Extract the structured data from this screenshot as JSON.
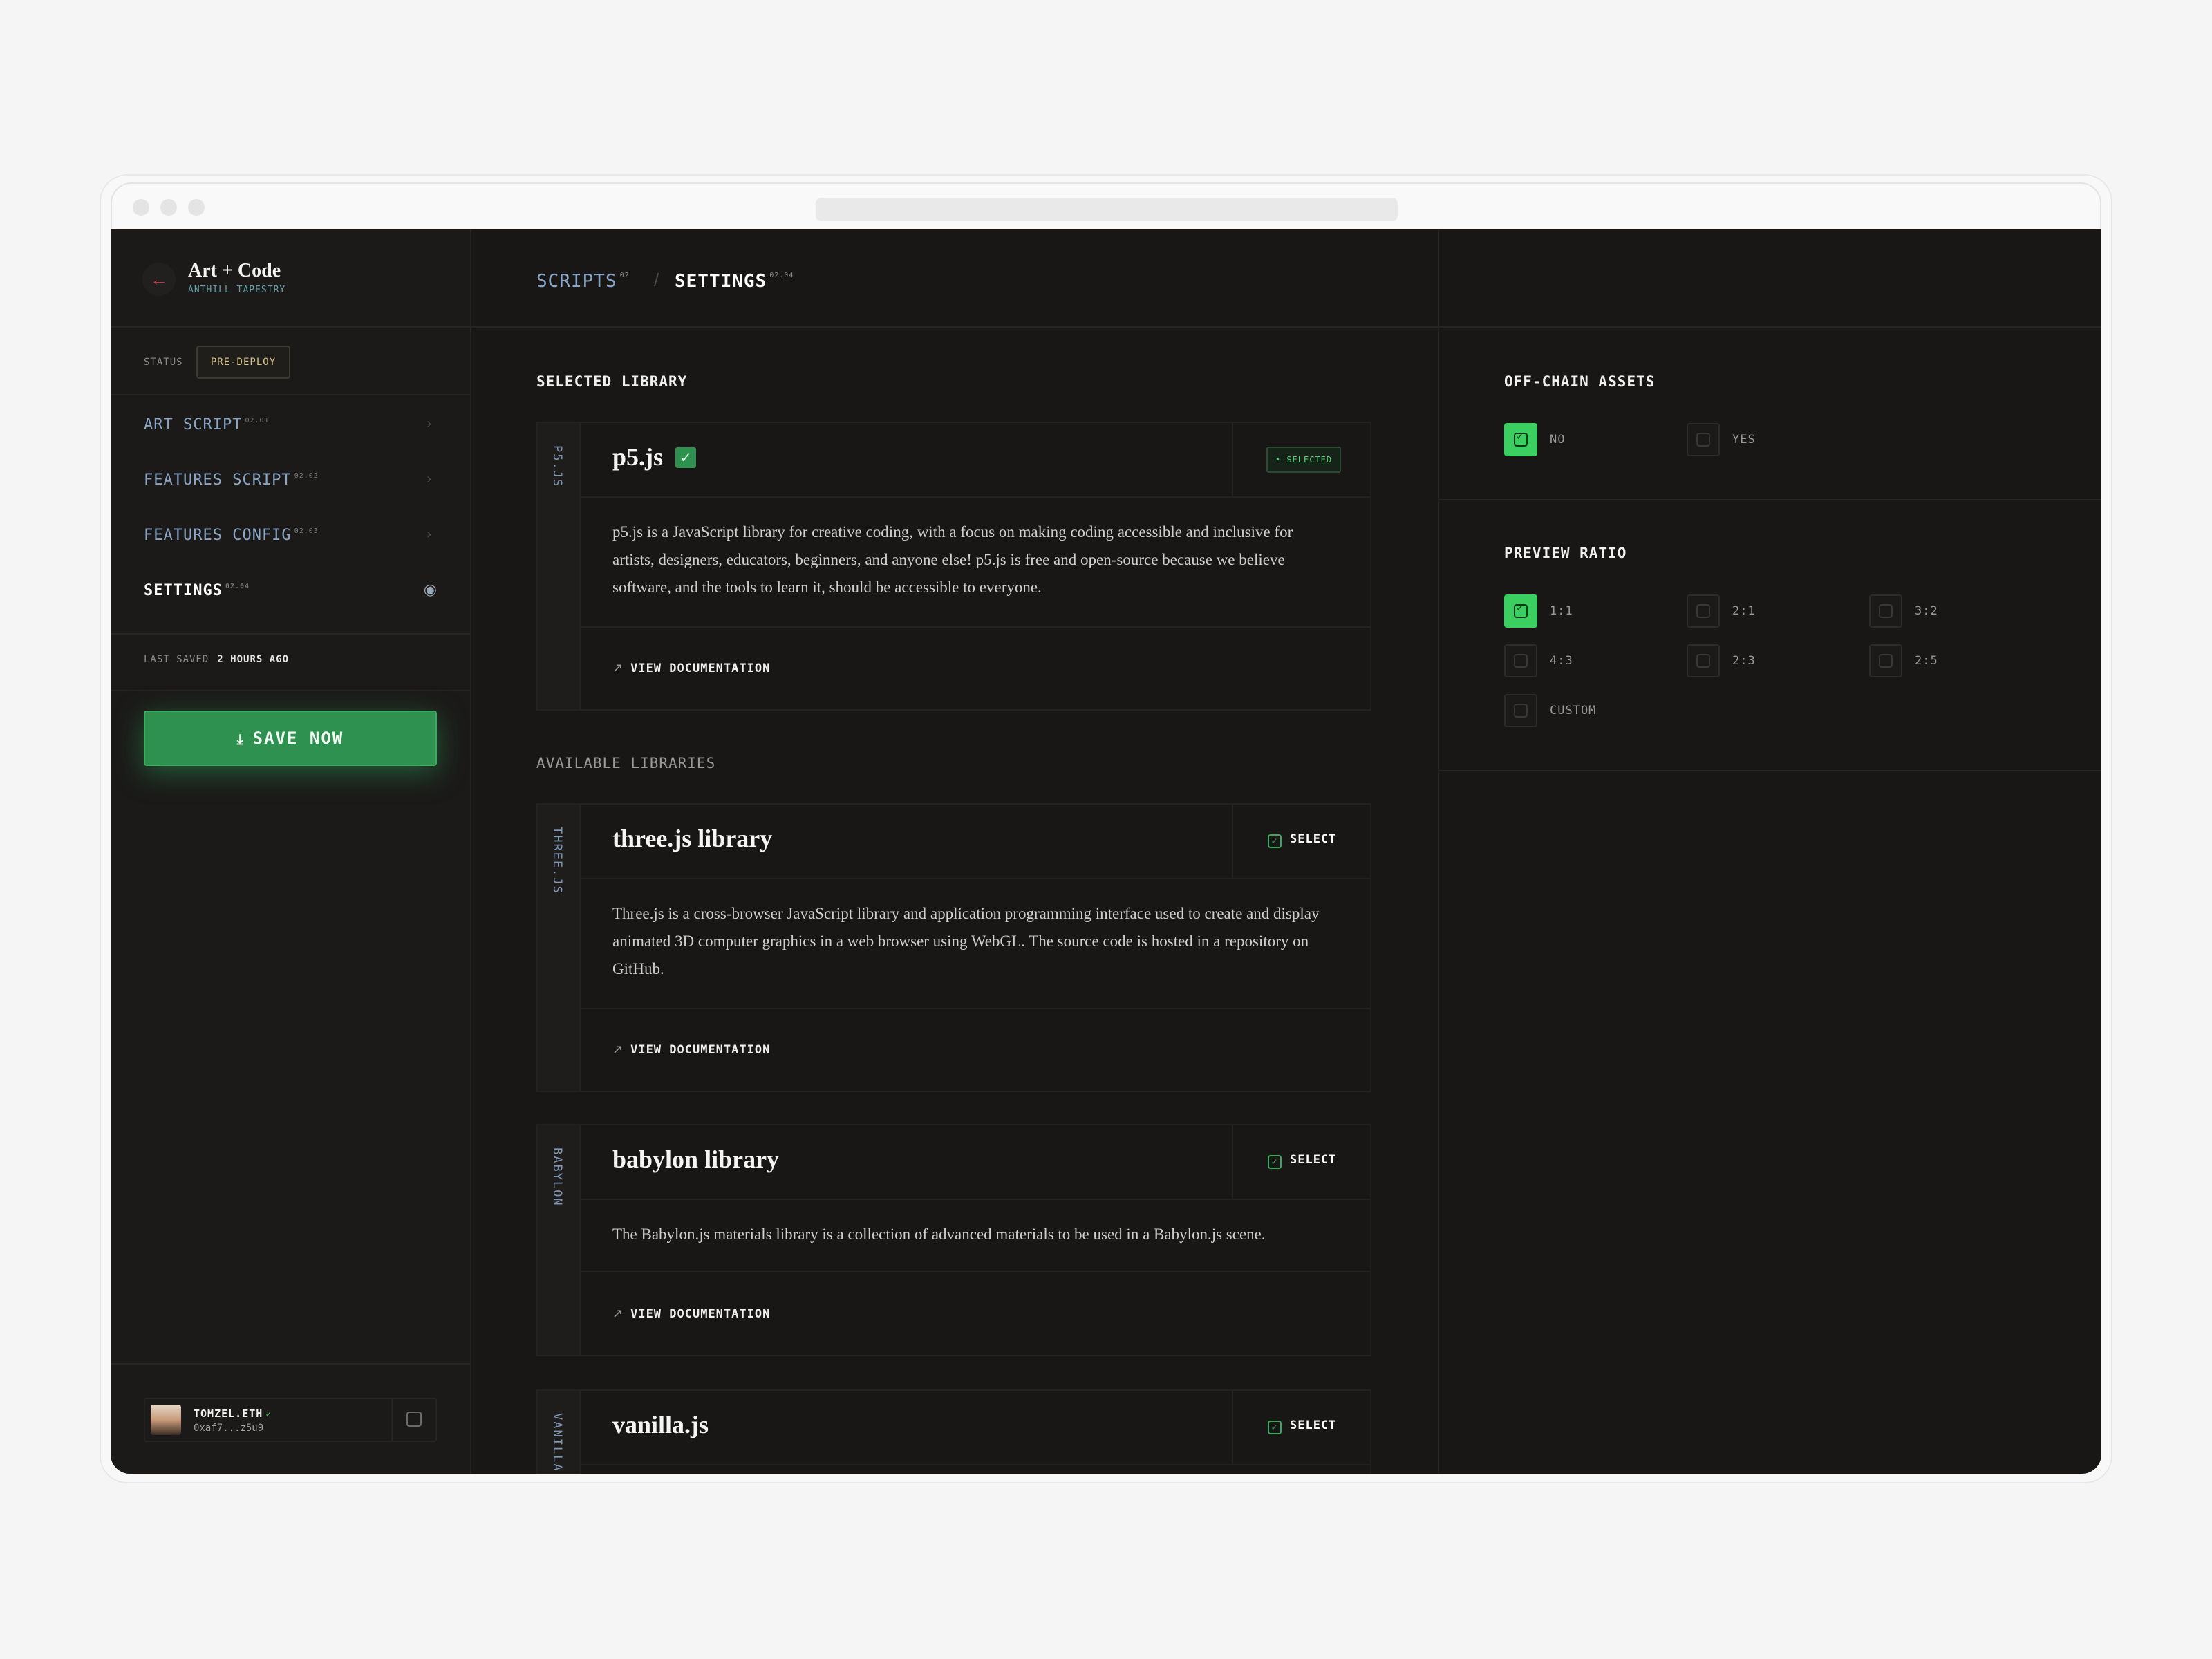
{
  "app": {
    "title": "Art + Code",
    "subtitle": "ANTHILL TAPESTRY"
  },
  "status": {
    "label": "STATUS",
    "value": "PRE-DEPLOY"
  },
  "nav": [
    {
      "label": "ART SCRIPT",
      "num": "02.01"
    },
    {
      "label": "FEATURES SCRIPT",
      "num": "02.02"
    },
    {
      "label": "FEATURES CONFIG",
      "num": "02.03"
    },
    {
      "label": "SETTINGS",
      "num": "02.04"
    }
  ],
  "saved": {
    "label": "LAST SAVED",
    "value": "2 HOURS AGO"
  },
  "save_button": "SAVE NOW",
  "user": {
    "name": "TOMZEL.ETH",
    "address": "0xaf7...z5u9"
  },
  "breadcrumb": {
    "first": "SCRIPTS",
    "first_num": "02",
    "second": "SETTINGS",
    "second_num": "02.04"
  },
  "selected_library": {
    "heading": "SELECTED LIBRARY",
    "tag": "P5.JS",
    "name": "p5.js",
    "badge": "• SELECTED",
    "description": "p5.js is a JavaScript library for creative coding, with a focus on making coding accessible and inclusive for artists, designers, educators, beginners, and anyone else! p5.js is free and open-source because we believe software, and the tools to learn it, should be accessible to everyone.",
    "doc_link": "VIEW DOCUMENTATION"
  },
  "available_heading": "AVAILABLE LIBRARIES",
  "libraries": [
    {
      "tag": "THREE.JS",
      "name": "three.js library",
      "action": "SELECT",
      "description": "Three.js is a cross-browser JavaScript library and application programming interface used to create and display animated 3D computer graphics in a web browser using WebGL. The source code is hosted in a repository on GitHub.",
      "doc_link": "VIEW DOCUMENTATION"
    },
    {
      "tag": "BABYLON",
      "name": "babylon library",
      "action": "SELECT",
      "description": "The Babylon.js materials library is a collection of advanced materials to be used in a Babylon.js scene.",
      "doc_link": "VIEW DOCUMENTATION"
    },
    {
      "tag": "VANILLA",
      "name": "vanilla.js",
      "action": "SELECT"
    }
  ],
  "offchain": {
    "heading": "OFF-CHAIN ASSETS",
    "options": [
      {
        "label": "NO",
        "checked": true
      },
      {
        "label": "YES",
        "checked": false
      }
    ]
  },
  "preview_ratio": {
    "heading": "PREVIEW RATIO",
    "options": [
      {
        "label": "1:1",
        "checked": true
      },
      {
        "label": "2:1",
        "checked": false
      },
      {
        "label": "3:2",
        "checked": false
      },
      {
        "label": "4:3",
        "checked": false
      },
      {
        "label": "2:3",
        "checked": false
      },
      {
        "label": "2:5",
        "checked": false
      },
      {
        "label": "CUSTOM",
        "checked": false
      }
    ]
  },
  "colors": {
    "accent": "#3bcf62",
    "button": "#2e9150",
    "background": "#181716",
    "nav_text": "#8aa6c6",
    "status_text": "#d8c38a"
  }
}
